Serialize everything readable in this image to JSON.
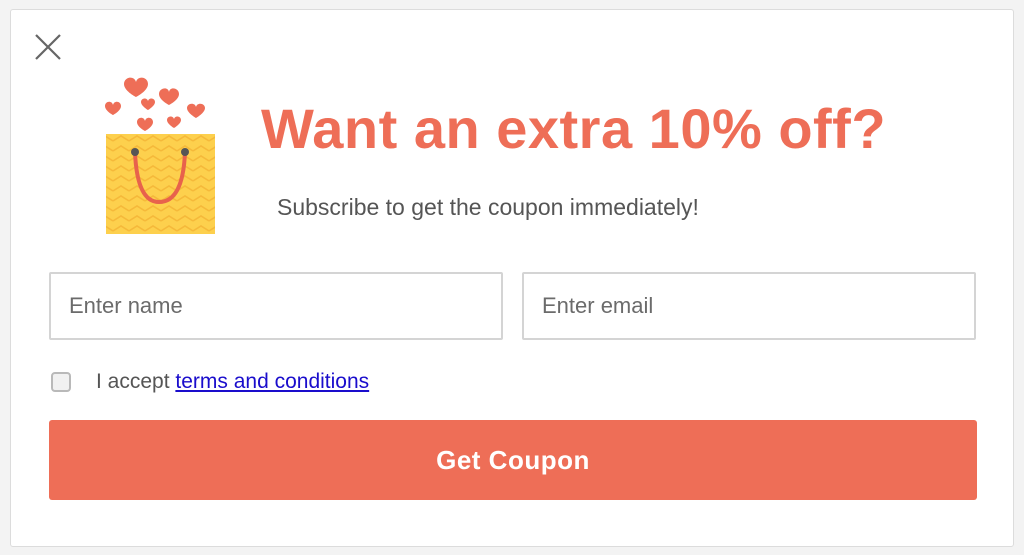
{
  "theme": {
    "accent": "#ee6e57",
    "bag_yellow": "#fdd04d",
    "bag_handle": "#e8624c"
  },
  "popup": {
    "close_icon": "close-icon",
    "illustration_icon": "shopping-bag-hearts-icon",
    "headline": "Want an extra 10% off?",
    "subline": "Subscribe to get the coupon immediately!"
  },
  "form": {
    "name_placeholder": "Enter name",
    "email_placeholder": "Enter email",
    "accept_prefix": "I accept ",
    "terms_link": "terms and conditions",
    "submit_label": "Get Coupon"
  }
}
